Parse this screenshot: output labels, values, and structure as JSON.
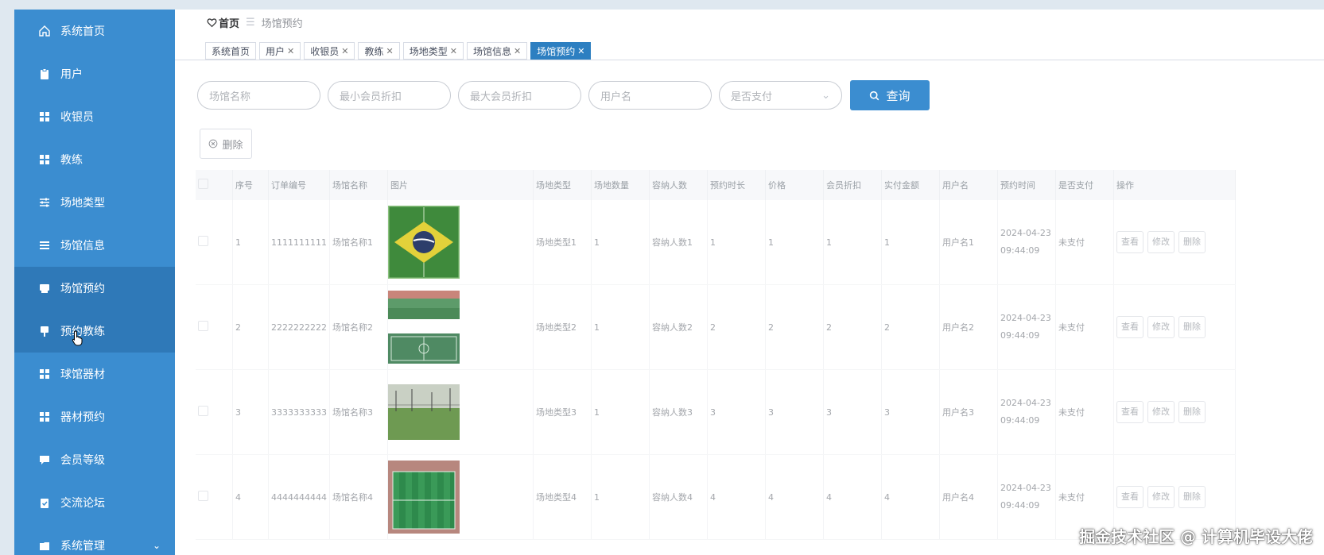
{
  "sidebar": {
    "items": [
      {
        "label": "系统首页",
        "icon": "home-icon"
      },
      {
        "label": "用户",
        "icon": "clipboard-icon"
      },
      {
        "label": "收银员",
        "icon": "grid-icon"
      },
      {
        "label": "教练",
        "icon": "grid-icon"
      },
      {
        "label": "场地类型",
        "icon": "sliders-icon"
      },
      {
        "label": "场馆信息",
        "icon": "list-icon"
      },
      {
        "label": "场馆预约",
        "icon": "printer-icon"
      },
      {
        "label": "预约教练",
        "icon": "pin-icon"
      },
      {
        "label": "球馆器材",
        "icon": "grid-icon"
      },
      {
        "label": "器材预约",
        "icon": "grid-icon"
      },
      {
        "label": "会员等级",
        "icon": "chat-icon"
      },
      {
        "label": "交流论坛",
        "icon": "clipboard-check-icon"
      },
      {
        "label": "系统管理",
        "icon": "folder-icon"
      }
    ]
  },
  "breadcrumb": {
    "home": "首页",
    "current": "场馆预约"
  },
  "tabs": [
    {
      "label": "系统首页"
    },
    {
      "label": "用户"
    },
    {
      "label": "收银员"
    },
    {
      "label": "教练"
    },
    {
      "label": "场地类型"
    },
    {
      "label": "场馆信息"
    },
    {
      "label": "场馆预约"
    }
  ],
  "search": {
    "venue_name": "场馆名称",
    "min_discount": "最小会员折扣",
    "max_discount": "最大会员折扣",
    "username": "用户名",
    "paid_select": "是否支付",
    "query_label": "查询"
  },
  "delete_label": "删除",
  "table": {
    "headers": [
      "序号",
      "订单编号",
      "场馆名称",
      "图片",
      "场地类型",
      "场地数量",
      "容纳人数",
      "预约时长",
      "价格",
      "会员折扣",
      "实付金额",
      "用户名",
      "预约时间",
      "是否支付",
      "操作"
    ],
    "rows": [
      {
        "no": "1",
        "order": "1111111111",
        "venue": "场馆名称1",
        "type": "场地类型1",
        "count": "1",
        "capacity": "容纳人数1",
        "duration": "1",
        "price": "1",
        "discount": "1",
        "paid_amount": "1",
        "user": "用户名1",
        "date": "2024-04-23",
        "time": "09:44:09",
        "paid": "未支付"
      },
      {
        "no": "2",
        "order": "2222222222",
        "venue": "场馆名称2",
        "type": "场地类型2",
        "count": "1",
        "capacity": "容纳人数2",
        "duration": "2",
        "price": "2",
        "discount": "2",
        "paid_amount": "2",
        "user": "用户名2",
        "date": "2024-04-23",
        "time": "09:44:09",
        "paid": "未支付"
      },
      {
        "no": "3",
        "order": "3333333333",
        "venue": "场馆名称3",
        "type": "场地类型3",
        "count": "1",
        "capacity": "容纳人数3",
        "duration": "3",
        "price": "3",
        "discount": "3",
        "paid_amount": "3",
        "user": "用户名3",
        "date": "2024-04-23",
        "time": "09:44:09",
        "paid": "未支付"
      },
      {
        "no": "4",
        "order": "4444444444",
        "venue": "场馆名称4",
        "type": "场地类型4",
        "count": "1",
        "capacity": "容纳人数4",
        "duration": "4",
        "price": "4",
        "discount": "4",
        "paid_amount": "4",
        "user": "用户名4",
        "date": "2024-04-23",
        "time": "09:44:09",
        "paid": "未支付"
      }
    ],
    "actions": {
      "view": "查看",
      "edit": "修改",
      "delete": "删除"
    }
  },
  "watermark": "掘金技术社区 @ 计算机毕设大佬",
  "colors": {
    "sidebar": "#3b8dd0",
    "sidebar_active": "#2f79b8",
    "primary": "#3b8dd0",
    "tab_active": "#2d7fc1"
  }
}
